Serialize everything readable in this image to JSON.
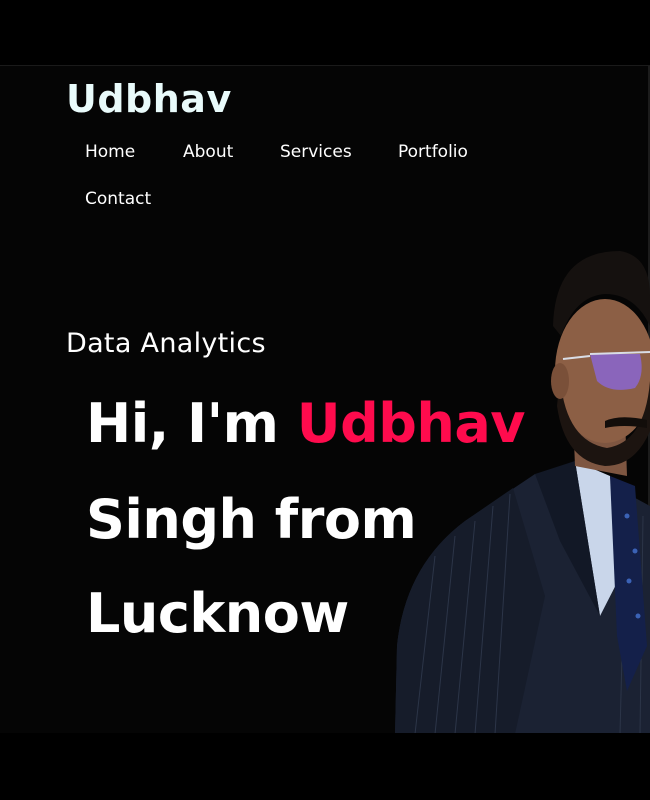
{
  "brand": {
    "logo_text": "Udbhav"
  },
  "nav": {
    "items": [
      "Home",
      "About",
      "Services",
      "Portfolio",
      "Contact"
    ]
  },
  "hero": {
    "subtitle": "Data Analytics",
    "greeting": "Hi, I'm",
    "name_highlight": "Udbhav",
    "line2": "Singh from",
    "line3": "Lucknow"
  },
  "colors": {
    "background": "#000000",
    "logo": "#e9fbfb",
    "accent": "#ff0b4d",
    "text": "#ffffff"
  },
  "icons": {
    "profile_photo": "person-in-suit-photo"
  }
}
